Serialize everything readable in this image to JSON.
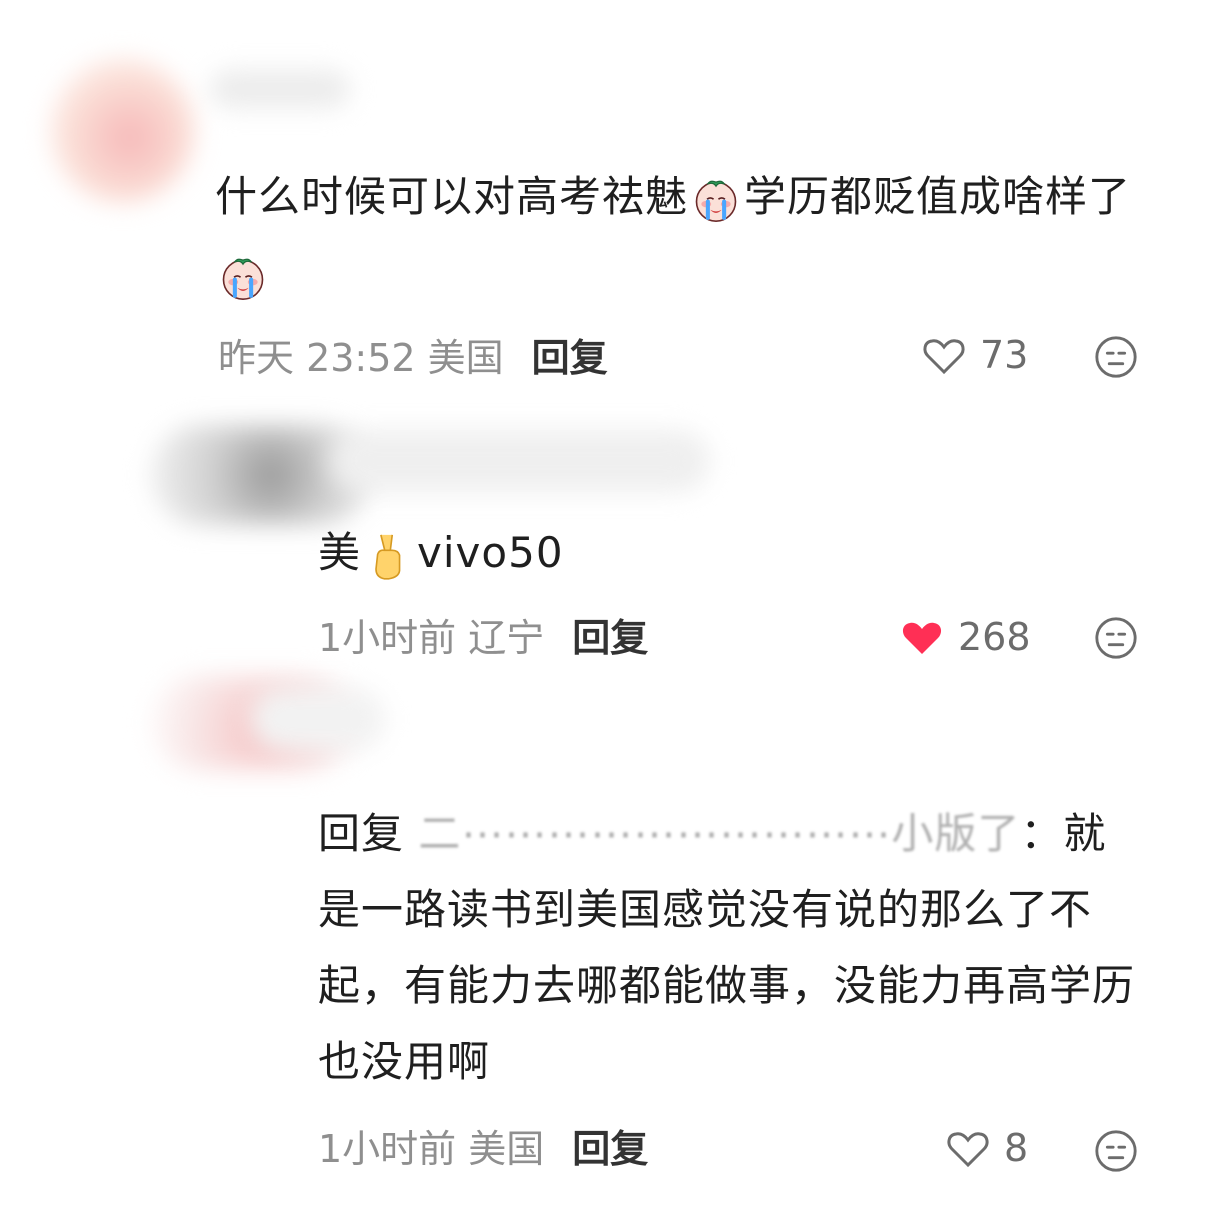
{
  "comments": [
    {
      "text_part_1": "什么时候可以对高考祛魅",
      "text_part_2": "学历都贬值成啥样了",
      "time_location": "昨天 23:52 美国",
      "reply_label": "回复",
      "likes": "73",
      "liked": false
    },
    {
      "text_prefix": "美",
      "text_suffix": "vivo50",
      "time_location": "1小时前 辽宁",
      "reply_label": "回复",
      "likes": "268",
      "liked": true
    },
    {
      "reply_prefix": "回复",
      "reply_target": "二⋯⋯⋯⋯⋯⋯⋯⋯⋯⋯小版了",
      "reply_colon": "：",
      "text": "就是一路读书到美国感觉没有说的那么了不起，有能力去哪都能做事，没能力再高学历也没用啊",
      "time_location": "1小时前 美国",
      "reply_label": "回复",
      "likes": "8",
      "liked": false
    }
  ],
  "icons": {
    "heart_outline": "heart-outline-icon",
    "heart_filled": "heart-filled-icon",
    "neutral_face": "neutral-face-icon",
    "crying_emoji": "crying-peach-emoji",
    "victory_hand": "victory-hand-emoji"
  },
  "colors": {
    "heart_red": "#ff2f55",
    "text_dark": "#1f1f1f",
    "meta_gray": "#8f8f8f"
  }
}
